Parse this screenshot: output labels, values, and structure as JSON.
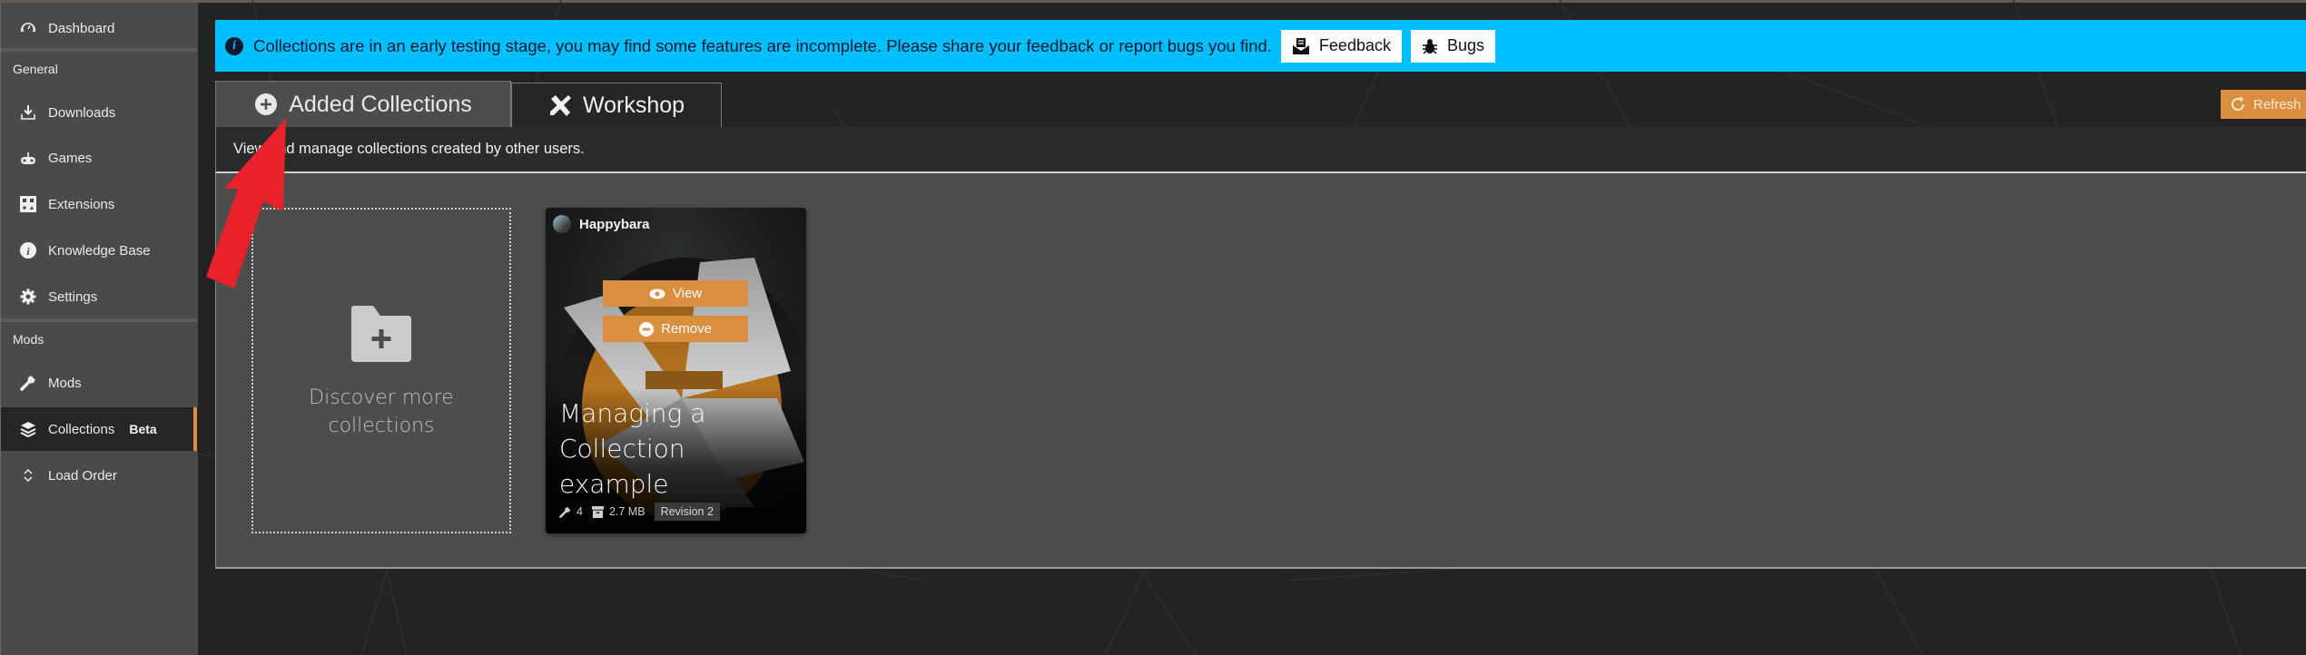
{
  "sidebar": {
    "top_item": {
      "label": "Dashboard",
      "icon": "dashboard-gauge-icon"
    },
    "sections": [
      {
        "header": "General",
        "items": [
          {
            "label": "Downloads",
            "icon": "download-icon"
          },
          {
            "label": "Games",
            "icon": "gamepad-icon"
          },
          {
            "label": "Extensions",
            "icon": "extensions-icon"
          },
          {
            "label": "Knowledge Base",
            "icon": "info-icon"
          },
          {
            "label": "Settings",
            "icon": "gear-icon"
          }
        ]
      },
      {
        "header": "Mods",
        "items": [
          {
            "label": "Mods",
            "icon": "wrench-icon"
          },
          {
            "label": "Collections",
            "icon": "layers-icon",
            "badge": "Beta",
            "active": true
          },
          {
            "label": "Load Order",
            "icon": "sort-icon"
          }
        ]
      }
    ]
  },
  "banner": {
    "icon": "info-icon",
    "text": "Collections are in an early testing stage, you may find some features are incomplete. Please share your feedback or report bugs you find.",
    "feedback_label": "Feedback",
    "bugs_label": "Bugs",
    "color": "#00bfff"
  },
  "tabs": [
    {
      "label": "Added Collections",
      "icon": "plus-circle-icon",
      "active": true
    },
    {
      "label": "Workshop",
      "icon": "tools-icon",
      "active": false
    }
  ],
  "refresh_label": "Refresh",
  "accent_color": "#d98f3f",
  "description": "View and manage collections created by other users.",
  "add_card": {
    "label_line1": "Discover more",
    "label_line2": "collections",
    "icon": "folder-plus-icon"
  },
  "collections": [
    {
      "author": "Happybara",
      "view_label": "View",
      "remove_label": "Remove",
      "title_line1": "Managing a",
      "title_line2": "Collection",
      "title_line3": "example",
      "mod_count": "4",
      "size": "2.7 MB",
      "revision": "Revision 2"
    }
  ]
}
